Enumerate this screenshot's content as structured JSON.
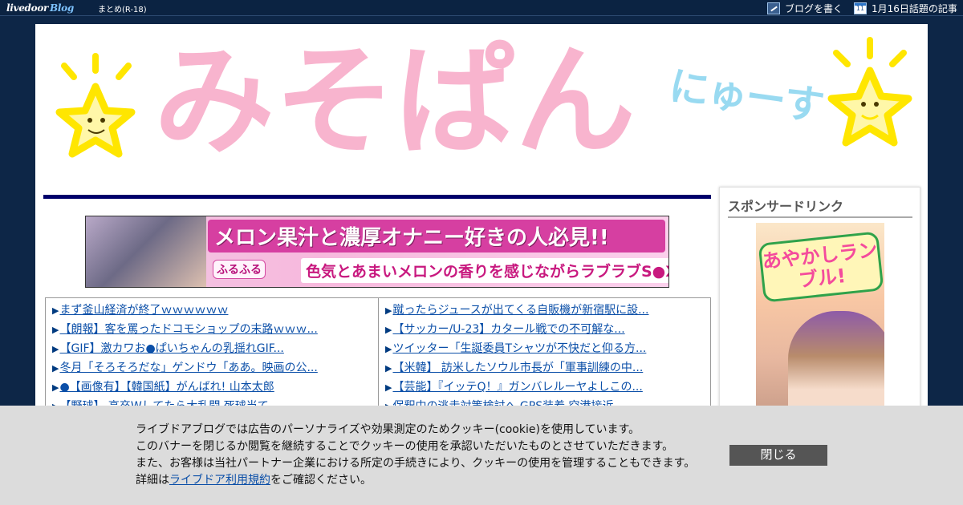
{
  "topbar": {
    "logo_text": "livedoor",
    "logo_blog": "Blog",
    "matome_link": "まとめ(R-18)",
    "write_blog": "ブログを書く",
    "calendar_day": "11",
    "trending": "1月16日話題の記事"
  },
  "header": {
    "title": "みそぱん",
    "subtitle": "にゅーす"
  },
  "ad_banner": {
    "headline": "メロン果汁と濃厚オナニー好きの人必見!!",
    "subline": "色気とあまいメロンの香りを感じながらラブラブS●X♥",
    "mini_logo": "ふるふる"
  },
  "links": {
    "left": [
      "まず釜山経済が終了ｗｗｗｗｗｗ",
      "【朗報】客を罵ったドコモショップの末路ｗｗｗ...",
      "【GIF】激カワお●ぱいちゃんの乳揺れGIF...",
      "冬月「そろそろだな」ゲンドウ「ああ。映画の公...",
      "●【画像有】【韓国紙】がんばれ! 山本太郎",
      "【野球】 高卒Wしてたら大乱闘 死球当て..."
    ],
    "right": [
      "蹴ったらジュースが出てくる自販機が新宿駅に設...",
      "【サッカー/U-23】カタール戦での不可解な...",
      "ツイッター「生誕委員Tシャツが不快だと仰る方...",
      "【米韓】 訪米したソウル市長が「軍事訓練の中...",
      "【芸能】『イッテQ！』ガンバレルーヤよしこの...",
      "保釈中の逃走対策検討へ GPS装着 空港接近..."
    ]
  },
  "sidebar": {
    "title": "スポンサードリンク",
    "ad_logo": "あやかしランブル!"
  },
  "cookie": {
    "line1": "ライブドアブログでは広告のパーソナライズや効果測定のためクッキー(cookie)を使用しています。",
    "line2": "このバナーを閉じるか閲覧を継続することでクッキーの使用を承認いただいたものとさせていただきます。",
    "line3": "また、お客様は当社パートナー企業における所定の手続きにより、クッキーの使用を管理することもできます。",
    "line4_prefix": "詳細は",
    "line4_link": "ライブドア利用規約",
    "line4_suffix": "をご確認ください。",
    "close_label": "閉じる"
  },
  "colors": {
    "topbar_bg": "#0b2342",
    "title_pink": "#f7a8c6",
    "subtitle_blue": "#8fd6f0",
    "star_yellow": "#ffec1a",
    "rule_navy": "#00006b",
    "link_blue": "#0b4fa8",
    "cookie_bg": "#dcdcdc",
    "close_btn_bg": "#555555"
  }
}
